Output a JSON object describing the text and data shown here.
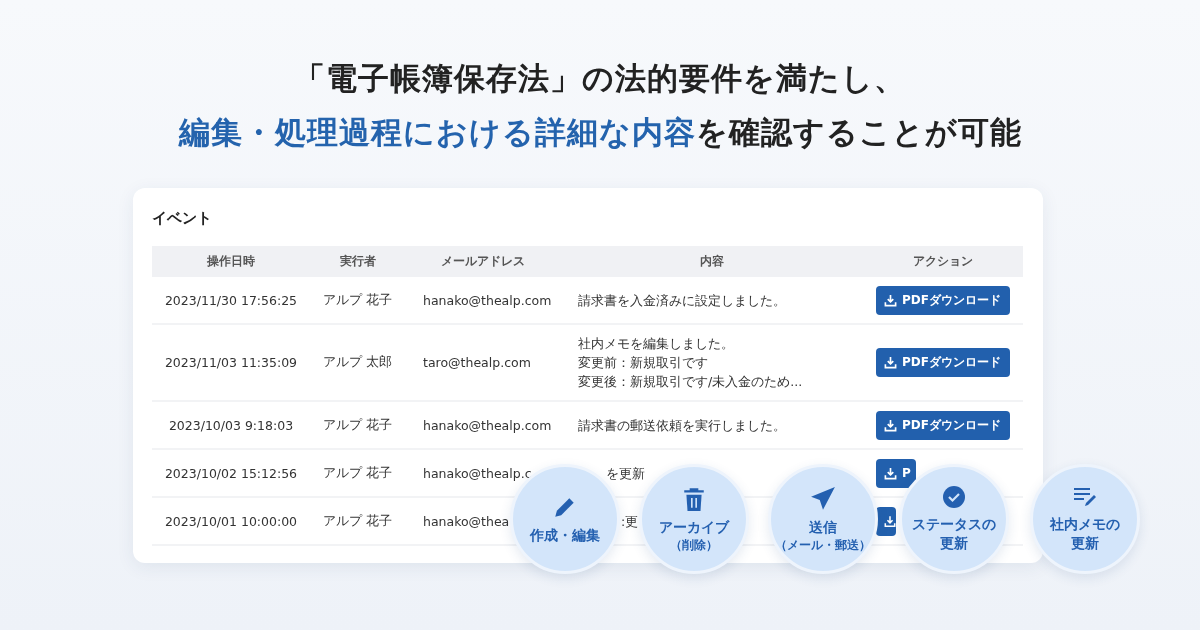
{
  "headline": [
    {
      "parts": [
        {
          "text": "「電子帳簿保存法」の法的要件を満たし、",
          "highlight": false
        }
      ]
    },
    {
      "parts": [
        {
          "text": "編集・処理過程における詳細な内容",
          "highlight": true
        },
        {
          "text": "を確認することが可能",
          "highlight": false
        }
      ]
    }
  ],
  "card": {
    "title": "イベント",
    "table": {
      "columns": [
        "操作日時",
        "実行者",
        "メールアドレス",
        "内容",
        "アクション"
      ],
      "rows": [
        {
          "datetime": "2023/11/30 17:56:25",
          "actor": "アルプ 花子",
          "email": "hanako@thealp.com",
          "content": [
            "請求書を入金済みに設定しました。"
          ],
          "action": {
            "kind": "full",
            "label": "PDFダウンロード"
          }
        },
        {
          "datetime": "2023/11/03 11:35:09",
          "actor": "アルプ 太郎",
          "email": "taro@thealp.com",
          "content": [
            "社内メモを編集しました。",
            "変更前：新規取引です",
            "変更後：新規取引です/未入金のため..."
          ],
          "action": {
            "kind": "full",
            "label": "PDFダウンロード"
          }
        },
        {
          "datetime": "2023/10/03 9:18:03",
          "actor": "アルプ 花子",
          "email": "hanako@thealp.com",
          "content": [
            "請求書の郵送依頼を実行しました。"
          ],
          "action": {
            "kind": "full",
            "label": "PDFダウンロード"
          }
        },
        {
          "datetime": "2023/10/02 15:12:56",
          "actor": "アルプ 花子",
          "email": "hanako@thealp.c",
          "content": [
            "を更新"
          ],
          "action": {
            "kind": "partial",
            "label": "P"
          }
        },
        {
          "datetime": "2023/10/01 10:00:00",
          "actor": "アルプ 花子",
          "email": "hanako@thea",
          "content": [
            ":更"
          ],
          "action": {
            "kind": "fragment"
          }
        }
      ]
    }
  },
  "features": [
    {
      "kind": "edit",
      "lines": [
        "作成・編集"
      ]
    },
    {
      "kind": "archive",
      "lines": [
        "アーカイブ",
        "（削除）"
      ]
    },
    {
      "kind": "send",
      "lines": [
        "送信",
        "（メール・郵送）"
      ]
    },
    {
      "kind": "status",
      "lines": [
        "ステータスの",
        "更新"
      ]
    },
    {
      "kind": "memo",
      "lines": [
        "社内メモの",
        "更新"
      ]
    }
  ]
}
